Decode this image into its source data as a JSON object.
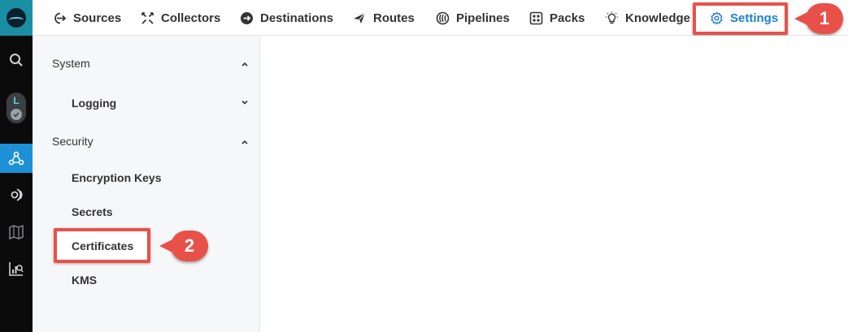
{
  "nav": {
    "items": [
      {
        "label": "Sources",
        "icon": "sources-icon"
      },
      {
        "label": "Collectors",
        "icon": "collectors-icon"
      },
      {
        "label": "Destinations",
        "icon": "destinations-icon"
      },
      {
        "label": "Routes",
        "icon": "routes-icon"
      },
      {
        "label": "Pipelines",
        "icon": "pipelines-icon"
      },
      {
        "label": "Packs",
        "icon": "packs-icon"
      },
      {
        "label": "Knowledge",
        "icon": "knowledge-icon"
      },
      {
        "label": "Settings",
        "icon": "gear-icon"
      }
    ],
    "active": "Settings"
  },
  "rail": {
    "badge_letter": "L"
  },
  "sidebar": {
    "system_label": "System",
    "logging_label": "Logging",
    "security_label": "Security",
    "security_items": [
      "Encryption Keys",
      "Secrets",
      "Certificates",
      "KMS"
    ]
  },
  "callouts": {
    "first": "1",
    "second": "2"
  },
  "colors": {
    "accent": "#1f7fd1",
    "highlight": "#e8514a",
    "rail": "#0b0b0b",
    "logo_bg": "#1a8fa3"
  }
}
